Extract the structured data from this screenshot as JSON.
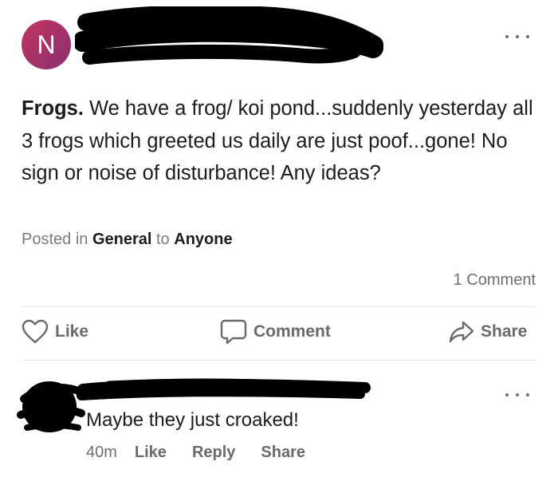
{
  "post": {
    "avatar_letter": "N",
    "title": "Frogs.",
    "body": " We have a frog/ koi pond...suddenly yesterday all 3 frogs which greeted us daily are just poof...gone! No sign or noise of disturbance! Any ideas?",
    "posted_in_prefix": "Posted in",
    "category": "General",
    "to_word": "to",
    "audience": "Anyone",
    "comment_count": "1 Comment"
  },
  "actions": {
    "like": "Like",
    "comment": "Comment",
    "share": "Share"
  },
  "comment": {
    "text": "Maybe they just croaked!",
    "age": "40m",
    "like": "Like",
    "reply": "Reply",
    "share": "Share"
  },
  "icons": {
    "more": "more-horizontal-icon",
    "like": "heart-outline-icon",
    "comment": "speech-bubble-icon",
    "share": "share-arrow-icon"
  },
  "colors": {
    "avatar_gradient_start": "#c2355f",
    "avatar_gradient_end": "#8a2f72",
    "text_primary": "#1c1c1e",
    "text_secondary": "#6f6f6f",
    "redaction": "#000000"
  }
}
